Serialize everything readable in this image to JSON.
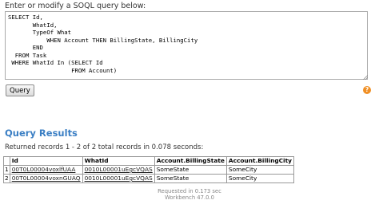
{
  "query_editor": {
    "label": "Enter or modify a SOQL query below:",
    "query": "SELECT Id,\n       WhatId,\n       TypeOf What\n           WHEN Account THEN BillingState, BillingCity\n       END\n  FROM Task\n WHERE WhatId In (SELECT Id\n                  FROM Account)",
    "submit_label": "Query",
    "help_icon": "question-mark-icon",
    "help_glyph": "?",
    "help_color": "#f08f24"
  },
  "results": {
    "heading": "Query Results",
    "heading_color": "#3b7fc4",
    "summary": "Returned records 1 - 2 of 2 total records in 0.078 seconds:",
    "columns": [
      "Id",
      "WhatId",
      "Account.BillingState",
      "Account.BillingCity"
    ],
    "rows": [
      {
        "num": "1",
        "id": "00T0L00004voxlfUAA",
        "what_id": "0010L00001uEgcVQAS",
        "billing_state": "SomeState",
        "billing_city": "SomeCity"
      },
      {
        "num": "2",
        "id": "00T0L00004voxnGUAQ",
        "what_id": "0010L00001uEgcVQAS",
        "billing_state": "SomeState",
        "billing_city": "SomeCity"
      }
    ]
  },
  "footer": {
    "requested": "Requested in 0.173 sec",
    "version": "Workbench 47.0.0"
  }
}
